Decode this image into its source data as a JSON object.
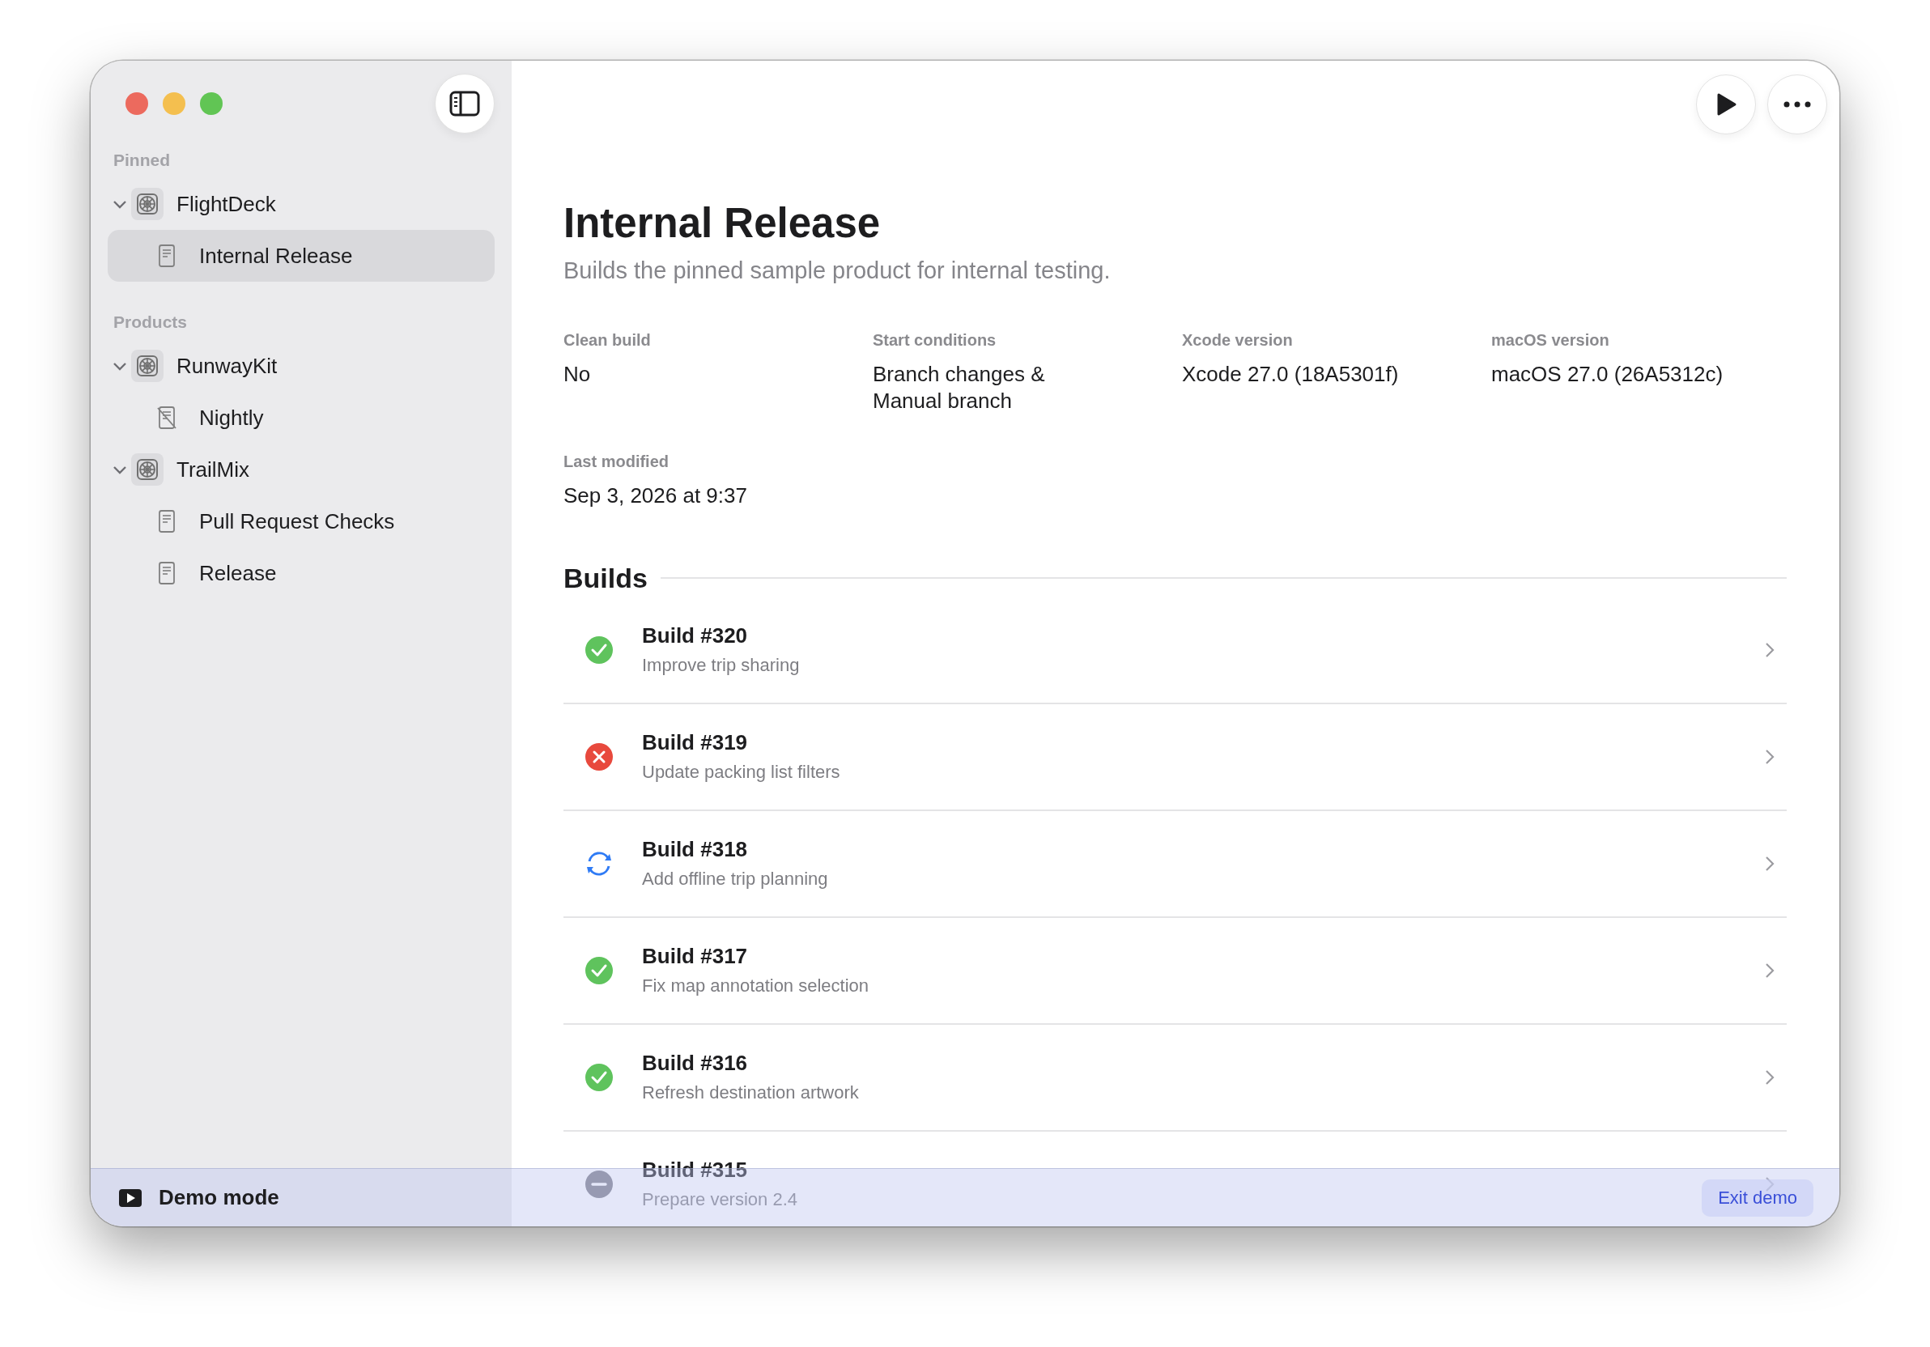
{
  "sidebar": {
    "sections": [
      {
        "title": "Pinned",
        "items": [
          {
            "label": "FlightDeck",
            "kind": "product",
            "expanded": true,
            "selected": false,
            "children": [
              {
                "label": "Internal Release",
                "kind": "scheme",
                "enabled": true,
                "selected": true
              }
            ]
          }
        ]
      },
      {
        "title": "Products",
        "items": [
          {
            "label": "RunwayKit",
            "kind": "product",
            "expanded": true,
            "selected": false,
            "children": [
              {
                "label": "Nightly",
                "kind": "scheme",
                "enabled": false,
                "selected": false
              }
            ]
          },
          {
            "label": "TrailMix",
            "kind": "product",
            "expanded": true,
            "selected": false,
            "children": [
              {
                "label": "Pull Request Checks",
                "kind": "scheme",
                "enabled": true,
                "selected": false
              },
              {
                "label": "Release",
                "kind": "scheme",
                "enabled": true,
                "selected": false
              }
            ]
          }
        ]
      }
    ]
  },
  "header": {
    "title": "Internal Release",
    "subtitle": "Builds the pinned sample product for internal testing."
  },
  "details": [
    {
      "label": "Clean build",
      "value": "No"
    },
    {
      "label": "Start conditions",
      "value": "Branch changes &\nManual branch"
    },
    {
      "label": "Xcode version",
      "value": "Xcode 27.0 (18A5301f)"
    },
    {
      "label": "macOS version",
      "value": "macOS 27.0 (26A5312c)"
    },
    {
      "label": "Last modified",
      "value": "Sep 3, 2026 at 9:37"
    }
  ],
  "builds": {
    "title": "Builds",
    "items": [
      {
        "title": "Build #320",
        "message": "Improve trip sharing",
        "kind": "succeeded"
      },
      {
        "title": "Build #319",
        "message": "Update packing list filters",
        "kind": "failed"
      },
      {
        "title": "Build #318",
        "message": "Add offline trip planning",
        "kind": "running"
      },
      {
        "title": "Build #317",
        "message": "Fix map annotation selection",
        "kind": "succeeded"
      },
      {
        "title": "Build #316",
        "message": "Refresh destination artwork",
        "kind": "succeeded"
      },
      {
        "title": "Build #315",
        "message": "Prepare version 2.4",
        "kind": "cancelled"
      }
    ]
  },
  "demo_bar": {
    "label": "Demo mode",
    "button": "Exit demo"
  }
}
